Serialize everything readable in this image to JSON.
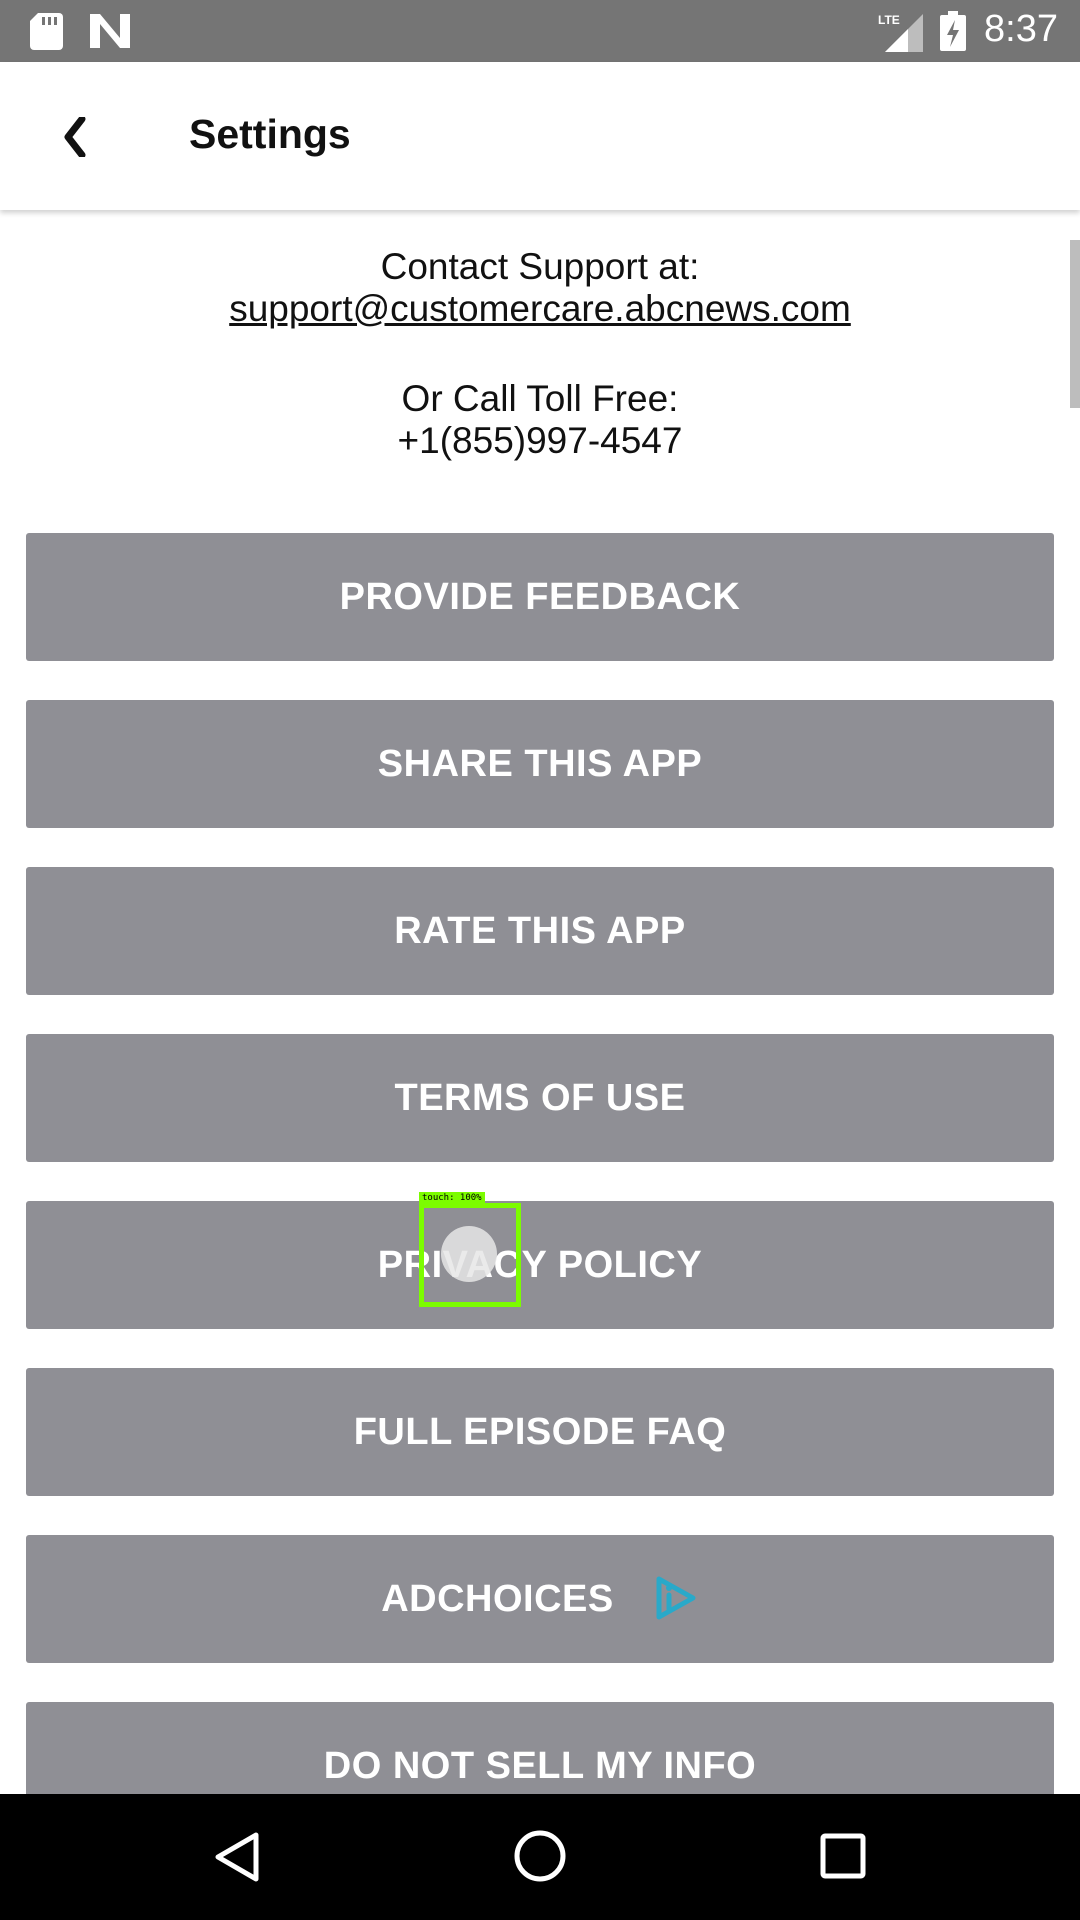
{
  "status_bar": {
    "network": "LTE",
    "time": "8:37"
  },
  "app_bar": {
    "back_icon": "chevron-left-icon",
    "title": "Settings"
  },
  "contact": {
    "support_label": "Contact Support at:",
    "support_email": "support@customercare.abcnews.com",
    "call_label": "Or Call Toll Free:",
    "phone": "+1(855)997-4547"
  },
  "buttons": [
    {
      "label": "PROVIDE FEEDBACK"
    },
    {
      "label": "SHARE THIS APP"
    },
    {
      "label": "RATE THIS APP"
    },
    {
      "label": "TERMS OF USE"
    },
    {
      "label": "PRIVACY POLICY"
    },
    {
      "label": "FULL EPISODE FAQ"
    },
    {
      "label": "ADCHOICES",
      "icon": "adchoices-icon"
    },
    {
      "label": "DO NOT SELL MY INFO"
    }
  ],
  "touch_overlay": {
    "label": "touch: 100%"
  },
  "colors": {
    "button_bg": "#8f8f95",
    "status_bar_bg": "#757575",
    "touch_box": "#7cfc00",
    "adchoices_accent": "#29a9c9"
  }
}
